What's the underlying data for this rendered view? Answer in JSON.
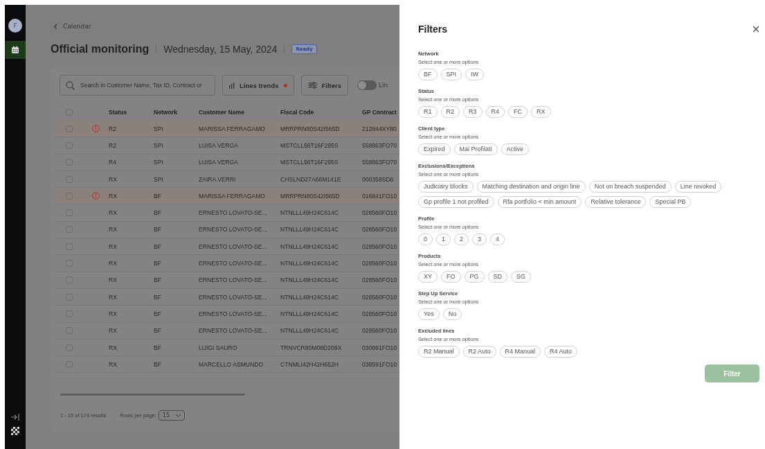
{
  "sidebar": {
    "avatar": "F",
    "items": [
      {
        "kind": "calendar",
        "selected": true
      }
    ],
    "footer_items": [
      {
        "kind": "collapse"
      },
      {
        "kind": "logo"
      }
    ]
  },
  "breadcrumb": {
    "label": "Calendar"
  },
  "header": {
    "title": "Official monitoring",
    "date": "Wednesday, 15 May, 2024",
    "badge": "Ready"
  },
  "toolbar": {
    "search": {
      "placeholder": "Search in Customer Name, Tax ID, Contract or"
    },
    "trends_button": {
      "label": "Lines trends",
      "alert_dot": true
    },
    "filters_button": {
      "label": "Filters"
    },
    "toggle": {
      "on": false,
      "label": "Lin"
    }
  },
  "table": {
    "select_all_checked": false,
    "columns": [
      "Status",
      "Network",
      "Customer Name",
      "Fiscal Code",
      "GP Contract"
    ],
    "rows": [
      {
        "checked": false,
        "alert": true,
        "cells": [
          "R2",
          "SPI",
          "MARISSA FERRAGAMO",
          "MRRPRN80S42I565D",
          "212844XY80"
        ]
      },
      {
        "checked": false,
        "alert": false,
        "cells": [
          "R2",
          "SPI",
          "LUISA VERGA",
          "MSTCLL56T16F295S",
          "558863FO70"
        ]
      },
      {
        "checked": false,
        "alert": false,
        "cells": [
          "R4",
          "SPI",
          "LUISA VERGA",
          "MSTCLL56T16F295S",
          "558863FO70"
        ]
      },
      {
        "checked": false,
        "alert": false,
        "cells": [
          "RX",
          "SPI",
          "ZAIRA VERRI",
          "CHSLND27A66M141E",
          "000358SD6"
        ]
      },
      {
        "checked": false,
        "alert": true,
        "cells": [
          "RX",
          "BF",
          "MARISSA FERRAGAMO",
          "MRRPRN80S42I565D",
          "016841FO10"
        ]
      },
      {
        "checked": false,
        "alert": false,
        "cells": [
          "RX",
          "BF",
          "ERNESTO LOVATO-SE...",
          "NTNLLL49H24C614C",
          "028560FO10"
        ]
      },
      {
        "checked": false,
        "alert": false,
        "cells": [
          "RX",
          "BF",
          "ERNESTO LOVATO-SE...",
          "NTNLLL49H24C614C",
          "028560FO10"
        ]
      },
      {
        "checked": false,
        "alert": false,
        "cells": [
          "RX",
          "BF",
          "ERNESTO LOVATO-SE...",
          "NTNLLL49H24C614C",
          "028560FO10"
        ]
      },
      {
        "checked": false,
        "alert": false,
        "cells": [
          "RX",
          "BF",
          "ERNESTO LOVATO-SE...",
          "NTNLLL49H24C614C",
          "028560FO10"
        ]
      },
      {
        "checked": false,
        "alert": false,
        "cells": [
          "RX",
          "BF",
          "ERNESTO LOVATO-SE...",
          "NTNLLL49H24C614C",
          "028560FO10"
        ]
      },
      {
        "checked": false,
        "alert": false,
        "cells": [
          "RX",
          "BF",
          "ERNESTO LOVATO-SE...",
          "NTNLLL49H24C614C",
          "028560FO10"
        ]
      },
      {
        "checked": false,
        "alert": false,
        "cells": [
          "RX",
          "BF",
          "ERNESTO LOVATO-SE...",
          "NTNLLL49H24C614C",
          "028560FO10"
        ]
      },
      {
        "checked": false,
        "alert": false,
        "cells": [
          "RX",
          "BF",
          "ERNESTO LOVATO-SE...",
          "NTNLLL49H24C614C",
          "028560FO10"
        ]
      },
      {
        "checked": false,
        "alert": false,
        "cells": [
          "RX",
          "BF",
          "LUIGI SAURO",
          "TRNVCR80M08D209X",
          "030891FO10"
        ]
      },
      {
        "checked": false,
        "alert": false,
        "cells": [
          "RX",
          "BF",
          "MARCELLO ASMUNDO",
          "CTNMLI42H42H652H",
          "038591FO10"
        ]
      }
    ]
  },
  "pagination": {
    "summary": "1 - 15 of 174 results",
    "rows_label": "Rows per page:",
    "rows_value": "15"
  },
  "drawer": {
    "title": "Filters",
    "sections": [
      {
        "label": "Network",
        "hint": "Select one or more options",
        "options": [
          {
            "label": "BF",
            "selected": false
          },
          {
            "label": "SPI",
            "selected": false
          },
          {
            "label": "IW",
            "selected": false
          }
        ]
      },
      {
        "label": "Status",
        "hint": "Select one or more options",
        "options": [
          {
            "label": "R1",
            "selected": false
          },
          {
            "label": "R2",
            "selected": false
          },
          {
            "label": "R3",
            "selected": false
          },
          {
            "label": "R4",
            "selected": false
          },
          {
            "label": "FC",
            "selected": false
          },
          {
            "label": "RX",
            "selected": false
          }
        ]
      },
      {
        "label": "Client type",
        "hint": "Select one or more options",
        "options": [
          {
            "label": "Expired",
            "selected": false
          },
          {
            "label": "Mai Profilati",
            "selected": false
          },
          {
            "label": "Active",
            "selected": false
          }
        ]
      },
      {
        "label": "Exclusions/Exceptions",
        "hint": "Select one or more options",
        "options": [
          {
            "label": "Judiciary blocks",
            "selected": false
          },
          {
            "label": "Matching destination and origin line",
            "selected": false
          },
          {
            "label": "Not on breach suspended",
            "selected": false
          },
          {
            "label": "Line revoked",
            "selected": false
          },
          {
            "label": "Gp profile 1 not profiled",
            "selected": false
          },
          {
            "label": "Rfa portfolio < min amount",
            "selected": false
          },
          {
            "label": "Relative tolerance",
            "selected": false
          },
          {
            "label": "Special PB",
            "selected": false
          }
        ]
      },
      {
        "label": "Profile",
        "hint": "Select one or more options",
        "options": [
          {
            "label": "0",
            "selected": false
          },
          {
            "label": "1",
            "selected": false
          },
          {
            "label": "2",
            "selected": false
          },
          {
            "label": "3",
            "selected": false
          },
          {
            "label": "4",
            "selected": false
          }
        ]
      },
      {
        "label": "Products",
        "hint": "Select one or more options",
        "options": [
          {
            "label": "XY",
            "selected": false
          },
          {
            "label": "FO",
            "selected": false
          },
          {
            "label": "PG",
            "selected": false
          },
          {
            "label": "SD",
            "selected": false
          },
          {
            "label": "SG",
            "selected": false
          }
        ]
      },
      {
        "label": "Step Up Service",
        "hint": "Select one or more options",
        "options": [
          {
            "label": "Yes",
            "selected": false
          },
          {
            "label": "No",
            "selected": false
          }
        ]
      },
      {
        "label": "Excluded lines",
        "hint": "Select one or more options",
        "options": [
          {
            "label": "R2 Manual",
            "selected": false
          },
          {
            "label": "R2 Auto",
            "selected": false
          },
          {
            "label": "R4 Manual",
            "selected": false
          },
          {
            "label": "R4 Auto",
            "selected": false
          }
        ]
      }
    ],
    "submit": {
      "label": "Filter",
      "disabled": true
    }
  }
}
